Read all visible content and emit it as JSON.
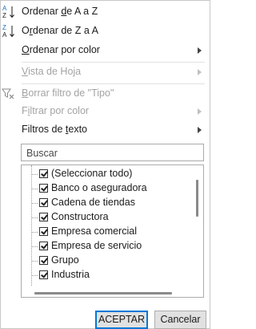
{
  "menu": {
    "sort_az": {
      "before": "Ordenar ",
      "key": "d",
      "after": "e A a Z",
      "icon_top": "A",
      "icon_bottom": "Z"
    },
    "sort_za": {
      "before": "O",
      "key": "r",
      "after": "denar de Z a A",
      "icon_top": "Z",
      "icon_bottom": "A"
    },
    "sort_color": {
      "before": "",
      "key": "O",
      "after": "rdenar por color"
    },
    "sheet_view": {
      "before": "",
      "key": "V",
      "after": "ista de Hoja"
    },
    "clear_filter": {
      "before": "",
      "key": "B",
      "after": "orrar filtro de \"Tipo\""
    },
    "filter_color": {
      "before": "F",
      "key": "i",
      "after": "ltrar por color"
    },
    "text_filters": {
      "before": "Filtros de ",
      "key": "t",
      "after": "exto"
    }
  },
  "search": {
    "placeholder": "Buscar"
  },
  "list": {
    "items": [
      {
        "label": "(Seleccionar todo)",
        "checked": true
      },
      {
        "label": "Banco o aseguradora",
        "checked": true
      },
      {
        "label": "Cadena de tiendas",
        "checked": true
      },
      {
        "label": "Constructora",
        "checked": true
      },
      {
        "label": "Empresa comercial",
        "checked": true
      },
      {
        "label": "Empresa de servicio",
        "checked": true
      },
      {
        "label": "Grupo",
        "checked": true
      },
      {
        "label": "Industria",
        "checked": true
      }
    ]
  },
  "buttons": {
    "ok": "ACEPTAR",
    "cancel": "Cancelar"
  },
  "colors": {
    "disabled_text": "#a3a3a3",
    "primary_border": "#0078d7",
    "button_bg": "#e1e1e1"
  }
}
